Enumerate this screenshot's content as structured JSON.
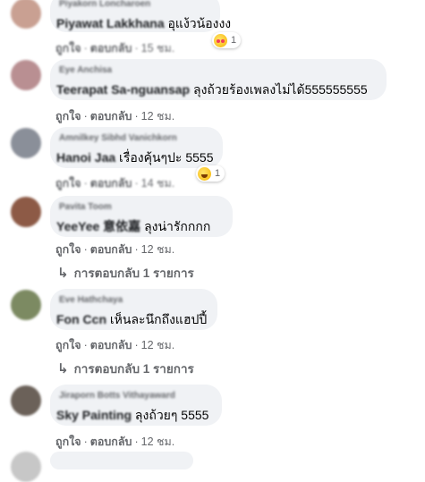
{
  "comments": [
    {
      "name": "Piyakorn Loncharoen",
      "prefix": "Piyawat Lakkhana",
      "text": "อุแง้วน้องงง",
      "actions": {
        "like": "ถูกใจ",
        "reply": "ตอบกลับ",
        "time": "15 ชม."
      },
      "reaction_count": "1",
      "reaction_icon": "love-emoji-icon",
      "avatar_color": "#c9a092"
    },
    {
      "name": "Eye Anchisa",
      "prefix": "Teerapat Sa-nguansap",
      "text": " ลุงถ้วยร้องเพลงไม่ได้555555555",
      "actions": {
        "like": "ถูกใจ",
        "reply": "ตอบกลับ",
        "time": "12 ชม."
      },
      "avatar_color": "#b98f92"
    },
    {
      "name": "Amnilkey Sibhd Vanichkorn",
      "prefix": "Hanoi Jaa",
      "text": " เรื่องคุ้นๆปะ 5555",
      "actions": {
        "like": "ถูกใจ",
        "reply": "ตอบกลับ",
        "time": "14 ชม."
      },
      "reaction_count": "1",
      "reaction_icon": "haha-emoji-icon",
      "avatar_color": "#8a8f99"
    },
    {
      "name": "Pavita Toom",
      "prefix": "YeeYee 意依嘉",
      "text": " ลุงน่ารักกกก",
      "actions": {
        "like": "ถูกใจ",
        "reply": "ตอบกลับ",
        "time": "12 ชม."
      },
      "replies": "การตอบกลับ 1 รายการ",
      "avatar_color": "#8d5a46"
    },
    {
      "name": "Eve Hathchaya",
      "prefix": "Fon Ccn",
      "text": " เห็นละนึกถึงแฮปปี้",
      "actions": {
        "like": "ถูกใจ",
        "reply": "ตอบกลับ",
        "time": "12 ชม."
      },
      "replies": "การตอบกลับ 1 รายการ",
      "avatar_color": "#7c8a62"
    },
    {
      "name": "Jiraporn Botts Vithayaward",
      "prefix": "Sky Painting",
      "text": " ลุงถ้วยๆ 5555",
      "actions": {
        "like": "ถูกใจ",
        "reply": "ตอบกลับ",
        "time": "12 ชม."
      },
      "avatar_color": "#6b6159"
    }
  ]
}
